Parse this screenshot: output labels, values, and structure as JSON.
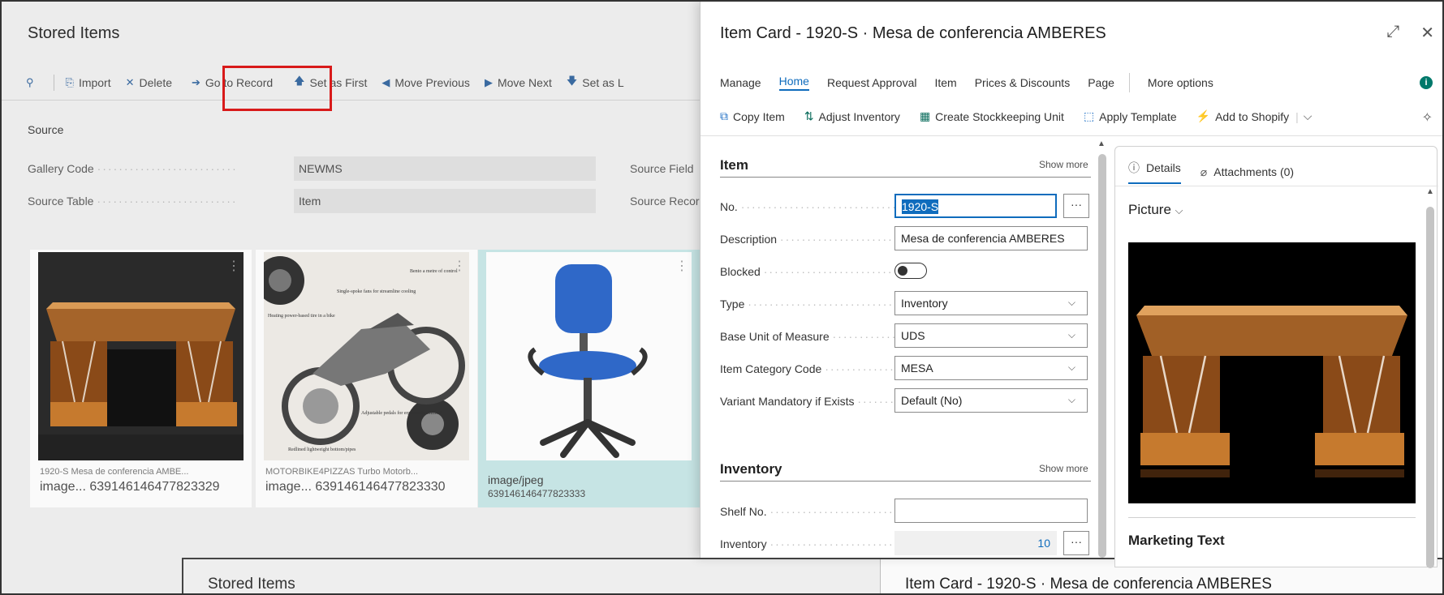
{
  "background": {
    "title": "Stored Items",
    "actions": [
      {
        "icon": "search-icon",
        "label": ""
      },
      {
        "icon": "import-icon",
        "label": "Import"
      },
      {
        "icon": "delete-icon",
        "label": "Delete"
      },
      {
        "icon": "arrow-right-icon",
        "label": "Go to Record"
      },
      {
        "icon": "arrow-up-icon",
        "label": "Set as First"
      },
      {
        "icon": "triangle-left-icon",
        "label": "Move Previous"
      },
      {
        "icon": "triangle-right-icon",
        "label": "Move Next"
      },
      {
        "icon": "arrow-down-icon",
        "label": "Set as L"
      }
    ],
    "source_heading": "Source",
    "fields": {
      "gallery_code_label": "Gallery Code",
      "gallery_code_value": "NEWMS",
      "source_table_label": "Source Table",
      "source_table_value": "Item",
      "source_field_label": "Source Field",
      "source_record_label": "Source Recor"
    },
    "cards": [
      {
        "caption_small": "1920-S Mesa de conferencia AMBE...",
        "caption_large": "image...   639146146477823329"
      },
      {
        "caption_small": "MOTORBIKE4PIZZAS Turbo Motorb...",
        "caption_large": "image...   639146146477823330"
      },
      {
        "caption_small": "image/jpeg",
        "caption_large": "639146146477823333"
      }
    ],
    "motorbike_callouts": [
      "Single-spoke fans for streamline cooling",
      "Bento a metre of control",
      "Heating power-based tire in a bike",
      "Redlined lightweight bottom/pipes",
      "Adjustable pedals for ergonomic comfort"
    ]
  },
  "panel": {
    "title": "Item Card - 1920-S · Mesa de conferencia AMBERES",
    "tabs": [
      "Manage",
      "Home",
      "Request Approval",
      "Item",
      "Prices & Discounts",
      "Page"
    ],
    "more_options": "More options",
    "actions": [
      {
        "icon": "copy-icon",
        "label": "Copy Item"
      },
      {
        "icon": "adjust-icon",
        "label": "Adjust Inventory"
      },
      {
        "icon": "stockkeeping-icon",
        "label": "Create Stockkeeping Unit"
      },
      {
        "icon": "template-icon",
        "label": "Apply Template"
      },
      {
        "icon": "shopify-icon",
        "label": "Add to Shopify"
      }
    ],
    "item_section": {
      "title": "Item",
      "show_more": "Show more",
      "fields": [
        {
          "label": "No.",
          "value": "1920-S"
        },
        {
          "label": "Description",
          "value": "Mesa de conferencia AMBERES"
        },
        {
          "label": "Blocked",
          "value": ""
        },
        {
          "label": "Type",
          "value": "Inventory"
        },
        {
          "label": "Base Unit of Measure",
          "value": "UDS"
        },
        {
          "label": "Item Category Code",
          "value": "MESA"
        },
        {
          "label": "Variant Mandatory if Exists",
          "value": "Default (No)"
        }
      ]
    },
    "inventory_section": {
      "title": "Inventory",
      "show_more": "Show more",
      "fields": [
        {
          "label": "Shelf No.",
          "value": ""
        },
        {
          "label": "Inventory",
          "value": "10"
        }
      ]
    },
    "factbox": {
      "tabs": [
        "Details",
        "Attachments (0)"
      ],
      "picture_label": "Picture",
      "marketing_label": "Marketing Text"
    }
  },
  "nested": {
    "title": "Stored Items",
    "panel_title": "Item Card - 1920-S · Mesa de conferencia AMBERES"
  }
}
